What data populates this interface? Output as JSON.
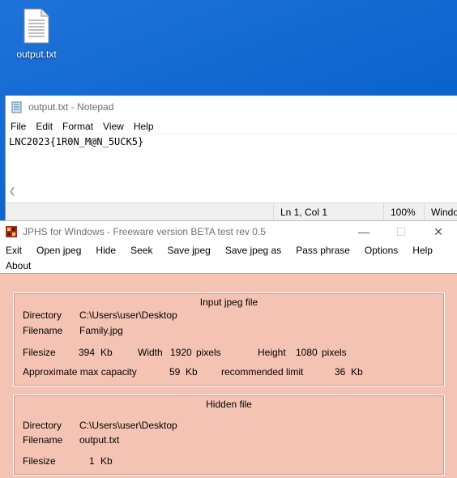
{
  "desktop": {
    "icon_label": "output.txt"
  },
  "notepad": {
    "title": "output.txt - Notepad",
    "menu": [
      "File",
      "Edit",
      "Format",
      "View",
      "Help"
    ],
    "content": "LNC2023{1R0N_M@N_5UCK5}",
    "status": {
      "position": "Ln 1, Col 1",
      "zoom": "100%",
      "encoding": "Windo"
    }
  },
  "jphs": {
    "title": "JPHS for WIndows - Freeware version BETA test rev 0.5",
    "menu_row1": [
      "Exit",
      "Open jpeg",
      "Hide",
      "Seek",
      "Save jpeg",
      "Save jpeg as",
      "Pass phrase",
      "Options",
      "Help"
    ],
    "menu_row2": [
      "About"
    ],
    "controls": {
      "minimize": "—",
      "maximize": "☐",
      "close": "✕"
    },
    "input_group": {
      "title": "Input jpeg file",
      "directory_label": "Directory",
      "directory_value": "C:\\Users\\user\\Desktop",
      "filename_label": "Filename",
      "filename_value": "Family.jpg",
      "filesize_label": "Filesize",
      "filesize_value": "394",
      "filesize_unit": "Kb",
      "width_label": "Width",
      "width_value": "1920",
      "width_unit": "pixels",
      "height_label": "Height",
      "height_value": "1080",
      "height_unit": "pixels",
      "capacity_label": "Approximate max capacity",
      "capacity_value": "59",
      "capacity_unit": "Kb",
      "recommended_label": "recommended limit",
      "recommended_value": "36",
      "recommended_unit": "Kb"
    },
    "hidden_group": {
      "title": "Hidden file",
      "directory_label": "Directory",
      "directory_value": "C:\\Users\\user\\Desktop",
      "filename_label": "Filename",
      "filename_value": "output.txt",
      "filesize_label": "Filesize",
      "filesize_value": "1",
      "filesize_unit": "Kb"
    }
  }
}
